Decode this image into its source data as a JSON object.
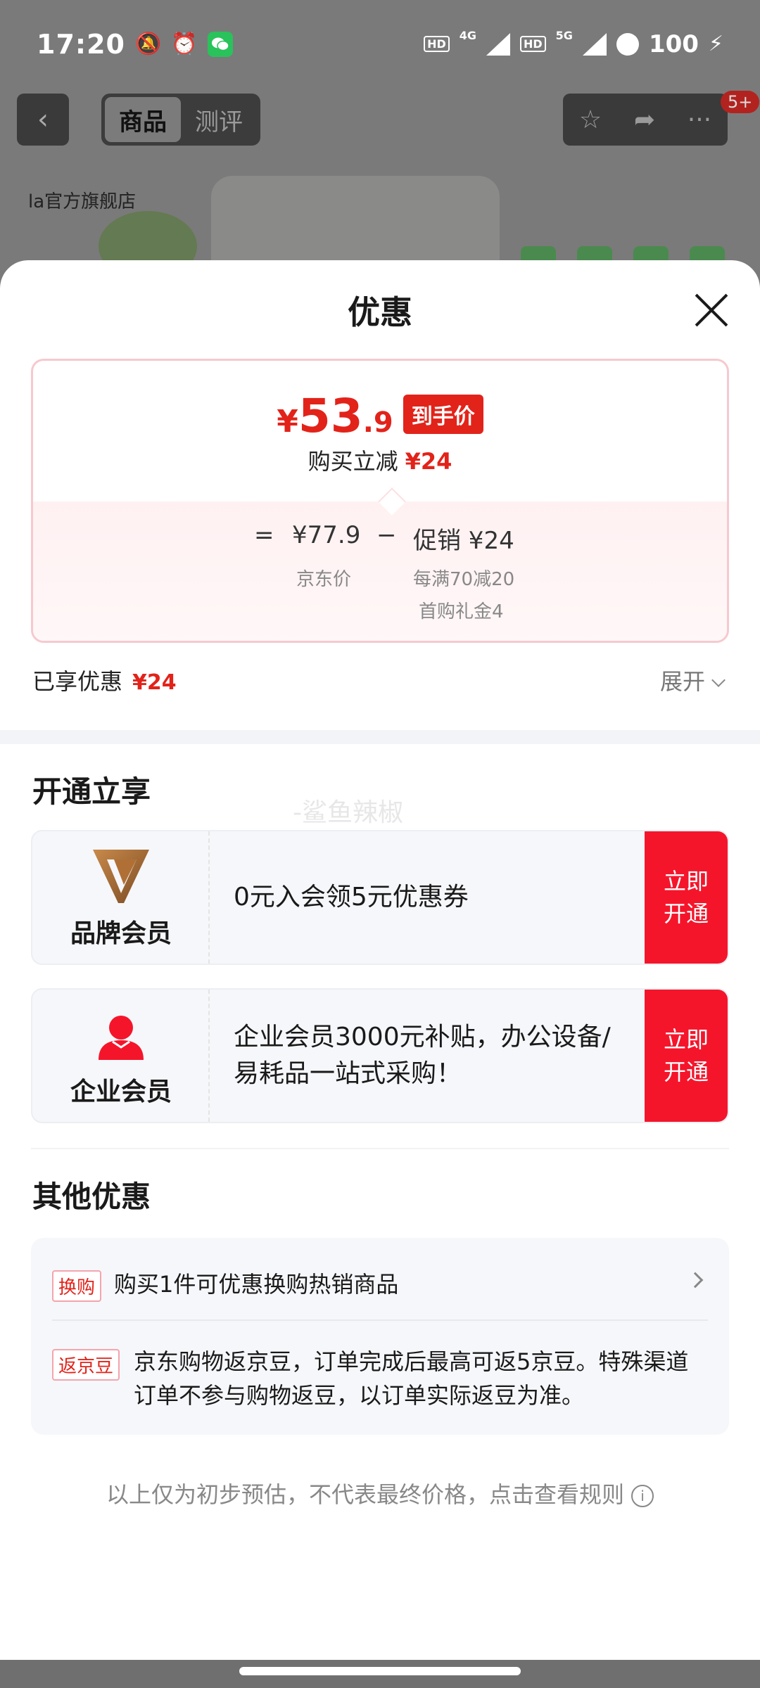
{
  "status": {
    "time": "17:20",
    "net1": "4G",
    "net2": "5G",
    "hd": "HD",
    "battery": "100"
  },
  "nav": {
    "tabs": [
      "商品",
      "测评"
    ],
    "badge": "5+",
    "store": "la官方旗舰店"
  },
  "sheet": {
    "title": "优惠",
    "price": {
      "currency": "¥",
      "final_int": "53",
      "final_dec": ".9",
      "final_tag": "到手价",
      "reduce_label": "购买立减",
      "reduce_value": "¥24",
      "equals": "=",
      "jd_price": "¥77.9",
      "jd_price_label": "京东价",
      "minus": "−",
      "promo": "促销 ¥24",
      "promo_detail1": "每满70减20",
      "promo_detail2": "首购礼金4"
    },
    "enjoyed_label": "已享优惠",
    "enjoyed_value": "¥24",
    "expand_label": "展开",
    "open_section_title": "开通立享",
    "watermark": "-鲨鱼辣椒",
    "members": [
      {
        "name": "品牌会员",
        "desc": "0元入会领5元优惠券",
        "button": "立即开通"
      },
      {
        "name": "企业会员",
        "desc": " 企业会员3000元补贴，办公设备/易耗品一站式采购！",
        "button": "立即开通"
      }
    ],
    "other_title": "其他优惠",
    "others": [
      {
        "tag": "换购",
        "text": "购买1件可优惠换购热销商品"
      },
      {
        "tag": "返京豆",
        "text": "京东购物返京豆，订单完成后最高可返5京豆。特殊渠道订单不参与购物返豆，以订单实际返豆为准。"
      }
    ],
    "footer_note": "以上仅为初步预估，不代表最终价格，点击查看规则",
    "colors": {
      "accent": "#e2231a",
      "button": "#f5152b"
    }
  }
}
